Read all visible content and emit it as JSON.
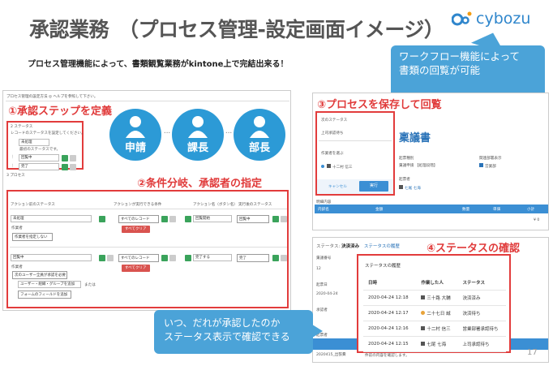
{
  "header": {
    "title": "承認業務　（プロセス管理-設定画面イメージ）",
    "subtitle": "プロセス管理機能によって、書類観覧業務がkintone上で完結出来る！",
    "logo_text": "cybozu"
  },
  "callout_top": {
    "line1": "ワークフロー機能によって",
    "line2": "書類の回覧が可能"
  },
  "left_panel": {
    "top_link": "プロセス管理の設定方法 ◎ ヘルプを参照して下さい。",
    "step1_label": "①承認ステップを定義",
    "section2_label": "2 ステータス",
    "status_desc": "レコードのステータスを設定してください。",
    "status_first": "未処理",
    "status_first_note": "最初のステータスです。",
    "status_rows": [
      "回覧中",
      "完了"
    ],
    "section3_label": "3 プロセス",
    "step2_label": "②条件分岐、承認者の指定",
    "roles": [
      "申請",
      "課長",
      "部長"
    ],
    "col_headers": [
      "アクション前のステータス",
      "アクションが実行できる条件",
      "アクション名（ボタン名）",
      "実行後のステータス"
    ],
    "row1": {
      "status": "未処理",
      "assignee_label": "作業者",
      "assignee": "作業者を指定しない",
      "cond": "すべてのレコード",
      "clear": "すべてクリア",
      "action": "回覧開始",
      "after": "回覧中"
    },
    "row2": {
      "status": "回覧中",
      "assignee_label": "作業者",
      "assignee": "次のユーザー全員が承認を必要",
      "user_placeholder": "ユーザー・組織・グループを追加",
      "or_label": "または",
      "field": "フォームのフィールドを追加",
      "cond": "すべてのレコード",
      "clear": "すべてクリア",
      "action": "完了する",
      "after": "完了"
    }
  },
  "right_top": {
    "step3_label": "③プロセスを保存して回覧",
    "next_status_label": "次のステータス",
    "next_status_value": "上司承認待ち",
    "assignee_label": "作業者を選ぶ",
    "assignee_value": "十二村 信三",
    "cancel": "キャンセル",
    "execute": "実行",
    "doc_title": "稟議書",
    "field1_label": "起票種別",
    "field1_value": "稟議申請 【処理段階】",
    "field2_label": "関連部署表示",
    "field2_value": "営業部",
    "field3_label": "起票者",
    "field3_value": "七尾 七海",
    "table_label": "明細内容",
    "table_headers": [
      "内訳名",
      "金額",
      "数量",
      "単価",
      "小計"
    ],
    "total": "¥ 0"
  },
  "right_bottom": {
    "status_prefix": "ステータス:",
    "status_value": "決済済み",
    "history_link": "ステータスの履歴",
    "step4_label": "④ステータスの確認",
    "side_labels": [
      "稟議番号",
      "12",
      "起票日",
      "2020-04-24",
      "承認者",
      "起票者",
      "2020415_出張費"
    ],
    "hist_title": "ステータスの履歴",
    "hist_headers": [
      "日時",
      "作業した人",
      "ステータス"
    ],
    "hist_rows": [
      {
        "time": "2020-04-24 12:18",
        "person": "三十路 大輔",
        "status": "決済済み"
      },
      {
        "time": "2020-04-24 12:17",
        "person": "二十七日 誠",
        "status": "決済待ち"
      },
      {
        "time": "2020-04-24 12:16",
        "person": "十二村 信三",
        "status": "営業部署承認待ち"
      },
      {
        "time": "2020-04-24 12:15",
        "person": "七尾 七海",
        "status": "上司承認待ち"
      }
    ],
    "footer_note": "件前の内容を確認します。"
  },
  "bubble": {
    "line1": "いつ、だれが承認したのか",
    "line2": "ステータス表示で確認できる"
  },
  "page_number": "17",
  "colors": {
    "accent": "#4ba3d8",
    "red": "#e03a3a",
    "brand": "#2f86cc"
  }
}
